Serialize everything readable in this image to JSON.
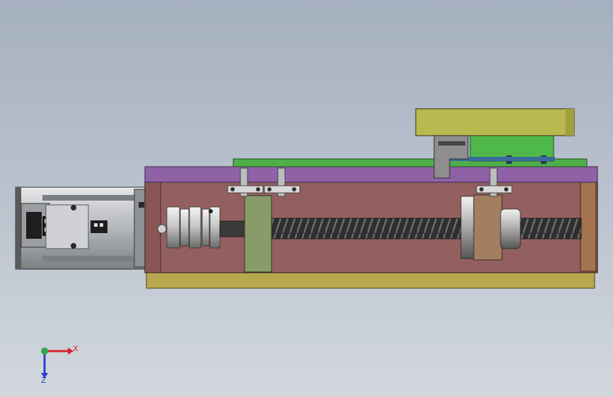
{
  "viewport": {
    "background_top": "#a5b0bf",
    "background_bottom": "#d3d8de"
  },
  "colors": {
    "motor_body": "#b9bcc0",
    "motor_dark": "#3a3a3a",
    "housing_side": "#93605f",
    "top_cover": "#8f62a8",
    "base_plate": "#b7a84f",
    "carriage_table": "#b9b94f",
    "linear_guide": "#4fae4a",
    "support_block": "#8a9b6a",
    "nut_block": "#a37e62",
    "bracket_grey": "#8e8e8e",
    "ball_screw": "#3b3b3b"
  },
  "components": [
    {
      "name": "servo-motor",
      "icon": "motor-icon"
    },
    {
      "name": "flexible-coupling",
      "icon": "coupling-icon"
    },
    {
      "name": "ball-screw",
      "icon": "screw-icon"
    },
    {
      "name": "fixed-support-block",
      "icon": "support-block-icon"
    },
    {
      "name": "ball-screw-nut",
      "icon": "nut-icon"
    },
    {
      "name": "slide-table",
      "icon": "table-icon"
    },
    {
      "name": "linear-guide-rail",
      "icon": "rail-icon"
    },
    {
      "name": "limit-sensors",
      "icon": "sensor-icon"
    }
  ],
  "triad": {
    "x_label": "X",
    "z_label": "Z",
    "x_color": "#d8232a",
    "y_color": "#2fa84a",
    "z_color": "#2b3fd0"
  }
}
